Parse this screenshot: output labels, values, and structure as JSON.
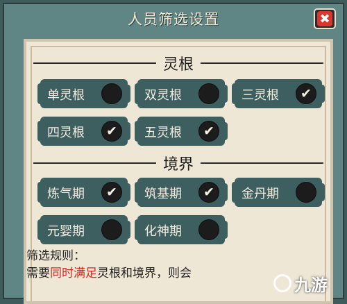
{
  "window": {
    "title": "人员筛选设置"
  },
  "close_button": {
    "symbol": "✖"
  },
  "sections": {
    "root": {
      "title": "灵根",
      "options": [
        {
          "label": "单灵根",
          "checked": false
        },
        {
          "label": "双灵根",
          "checked": false
        },
        {
          "label": "三灵根",
          "checked": true
        },
        {
          "label": "四灵根",
          "checked": true
        },
        {
          "label": "五灵根",
          "checked": true
        }
      ]
    },
    "realm": {
      "title": "境界",
      "options": [
        {
          "label": "炼气期",
          "checked": true
        },
        {
          "label": "筑基期",
          "checked": true
        },
        {
          "label": "金丹期",
          "checked": false
        },
        {
          "label": "元婴期",
          "checked": false
        },
        {
          "label": "化神期",
          "checked": false
        }
      ]
    }
  },
  "rules": {
    "title": "筛选规则：",
    "text_pre": "需要",
    "text_highlight": "同时满足",
    "text_post": "灵根和境界，则会"
  },
  "watermark": {
    "text": "九游"
  },
  "colors": {
    "accent_red": "#d4281f",
    "button_teal": "#3e5f60",
    "panel_bg": "#efe7d6"
  }
}
